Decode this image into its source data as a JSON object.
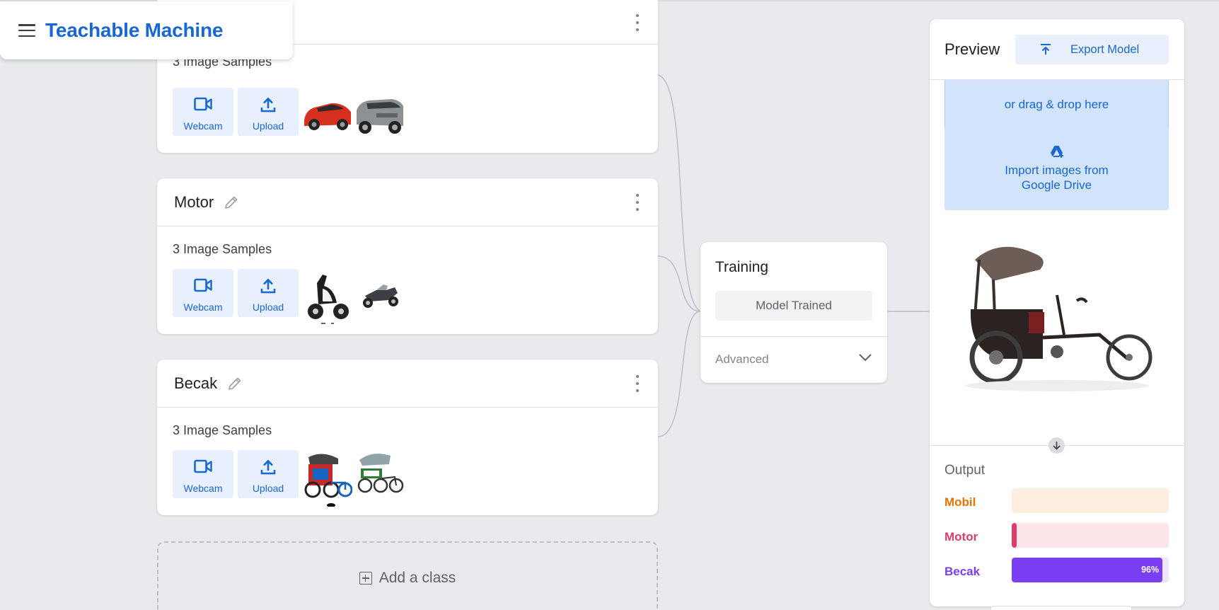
{
  "header": {
    "brand_title": "Teachable Machine"
  },
  "classes": [
    {
      "name": "",
      "samples_text": "3 Image Samples",
      "webcam_label": "Webcam",
      "upload_label": "Upload"
    },
    {
      "name": "Motor",
      "samples_text": "3 Image Samples",
      "webcam_label": "Webcam",
      "upload_label": "Upload"
    },
    {
      "name": "Becak",
      "samples_text": "3 Image Samples",
      "webcam_label": "Webcam",
      "upload_label": "Upload"
    }
  ],
  "add_class": {
    "label": "Add a class"
  },
  "training": {
    "title": "Training",
    "status_button": "Model Trained",
    "advanced_label": "Advanced"
  },
  "preview": {
    "title": "Preview",
    "export_label": "Export Model",
    "drop_text": "or drag & drop here",
    "drive_line1": "Import images from",
    "drive_line2": "Google Drive",
    "output_title": "Output",
    "outputs": [
      {
        "label": "Mobil",
        "value": 0.0,
        "color": "#e37400",
        "track": "#fdeee0",
        "percent_text": ""
      },
      {
        "label": "Motor",
        "value": 0.02,
        "color": "#d93d6a",
        "track": "#fde4e8",
        "percent_text": ""
      },
      {
        "label": "Becak",
        "value": 0.96,
        "color": "#7a3ff2",
        "track": "#efe6fd",
        "percent_text": "96%"
      }
    ]
  },
  "colors": {
    "accent_blue": "#1967d2",
    "button_bg": "#e8f0fe",
    "page_bg": "#e8eaed"
  }
}
